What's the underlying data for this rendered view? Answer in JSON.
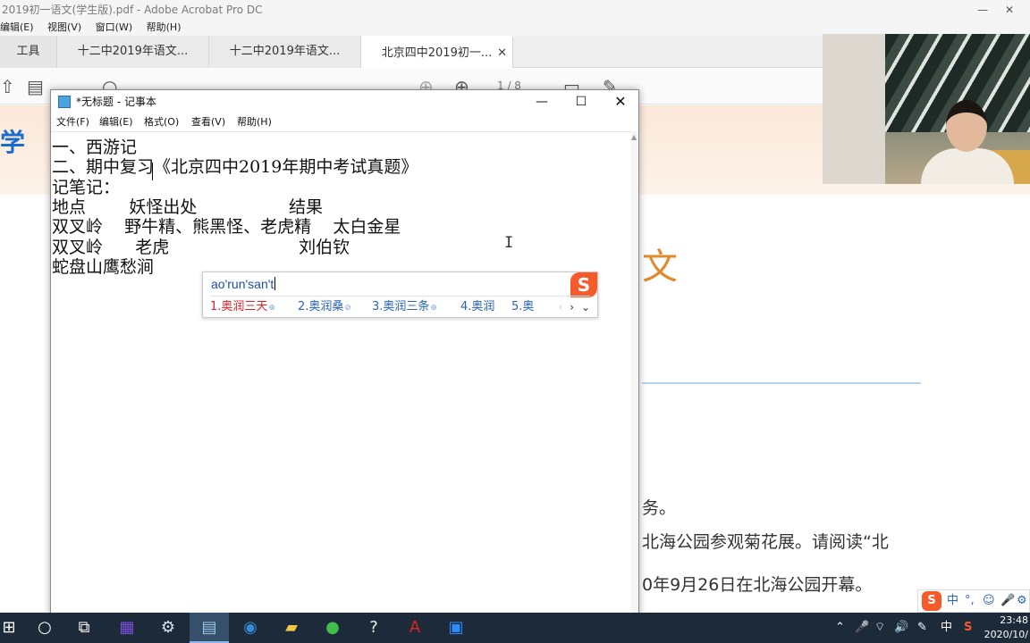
{
  "acrobat": {
    "window_title": "2019初一语文(学生版).pdf - Adobe Acrobat Pro DC",
    "minimize_glyph": "—",
    "close_glyph": "✕",
    "menu": [
      "编辑(E)",
      "视图(V)",
      "窗口(W)",
      "帮助(H)"
    ],
    "tabs": {
      "tools": "工具",
      "doc1": "十二中2019年语文...",
      "doc2": "十二中2019年语文...",
      "doc3": "北京四中2019初一..."
    },
    "close_glyph_tab": "✕",
    "page_indicator": "1 / 8",
    "page": {
      "logo_text": "学",
      "subject": "文",
      "line_1": "务。",
      "line_2": "北海公园参观菊花展。请阅读“北",
      "line_3": "0年9月26日在北海公园开幕。"
    }
  },
  "notepad": {
    "title": "*无标题 - 记事本",
    "menu": {
      "file": "文件(F)",
      "edit": "编辑(E)",
      "format": "格式(O)",
      "view": "查看(V)",
      "help": "帮助(H)"
    },
    "controls": {
      "minimize": "—",
      "maximize": "☐",
      "close": "✕"
    },
    "lines": [
      "一、西游记",
      "二、期中复习《北京四中2019年期中考试真题》",
      "记笔记：",
      "地点        妖怪出处                 结果",
      "双叉岭    野牛精、熊黑怪、老虎精    太白金星",
      "双叉岭      老虎                        刘伯钦",
      "蛇盘山鹰愁涧"
    ]
  },
  "ime": {
    "pinyin": "ao'run'san't",
    "logo": "S",
    "candidates": [
      {
        "label": "1.奥润三天",
        "tag": "⊕"
      },
      {
        "label": "2.奥润桑",
        "tag": "⊘"
      },
      {
        "label": "3.奥润三条",
        "tag": "⊕"
      },
      {
        "label": "4.奥润",
        "tag": ""
      },
      {
        "label": "5.奥",
        "tag": ""
      }
    ],
    "nav": {
      "prev": "‹",
      "next": "›",
      "expand": "⌄"
    },
    "status": {
      "logo": "S",
      "mode": "中",
      "punct": "°,",
      "emoji": "☺",
      "voice": "🎤",
      "skin": "⚙"
    }
  },
  "taskbar": {
    "start_glyph": "⊞",
    "search_glyph": "○",
    "taskview_glyph": "⧉",
    "apps": [
      {
        "name": "app-purple",
        "glyph": "▦",
        "color": "#7b4fd8"
      },
      {
        "name": "app-settings",
        "glyph": "⚙",
        "color": "#d8e4f0"
      },
      {
        "name": "app-notepad",
        "glyph": "▤",
        "color": "#9bc8ea"
      },
      {
        "name": "app-browser",
        "glyph": "◉",
        "color": "#3a8ad8"
      },
      {
        "name": "app-explorer",
        "glyph": "▰",
        "color": "#f2c744"
      },
      {
        "name": "app-wechat",
        "glyph": "●",
        "color": "#3fbf4a"
      },
      {
        "name": "app-unknown",
        "glyph": "?",
        "color": "#f0f0f0"
      },
      {
        "name": "app-acrobat",
        "glyph": "A",
        "color": "#d9261c"
      },
      {
        "name": "app-zoom",
        "glyph": "▣",
        "color": "#2d8cff"
      }
    ],
    "tray": {
      "chevron": "⌃",
      "mic": "🎤",
      "wifi": "⌔",
      "volume": "🔊",
      "pen": "✎",
      "ime": "中",
      "sogou": "S"
    },
    "time": "23:48",
    "date": "2020/10/"
  }
}
